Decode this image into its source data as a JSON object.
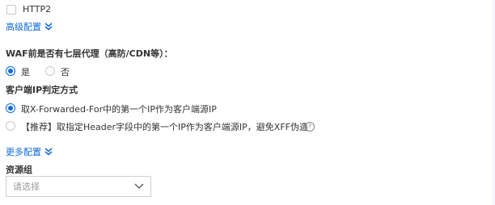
{
  "http2": {
    "label": "HTTP2"
  },
  "advanced_config": {
    "label": "高级配置"
  },
  "waf_proxy": {
    "label": "WAF前是否有七层代理（高防/CDN等）：",
    "options": [
      {
        "label": "是",
        "checked": true
      },
      {
        "label": "否",
        "checked": false
      }
    ]
  },
  "client_ip": {
    "label": "客户端IP判定方式",
    "options": [
      {
        "label": "取X-Forwarded-For中的第一个IP作为客户端源IP",
        "checked": true
      },
      {
        "label": "【推荐】取指定Header字段中的第一个IP作为客户端源IP，避免XFF伪造",
        "checked": false
      }
    ],
    "help_glyph": "?"
  },
  "more_config": {
    "label": "更多配置"
  },
  "resource_group": {
    "label": "资源组",
    "placeholder": "请选择"
  }
}
